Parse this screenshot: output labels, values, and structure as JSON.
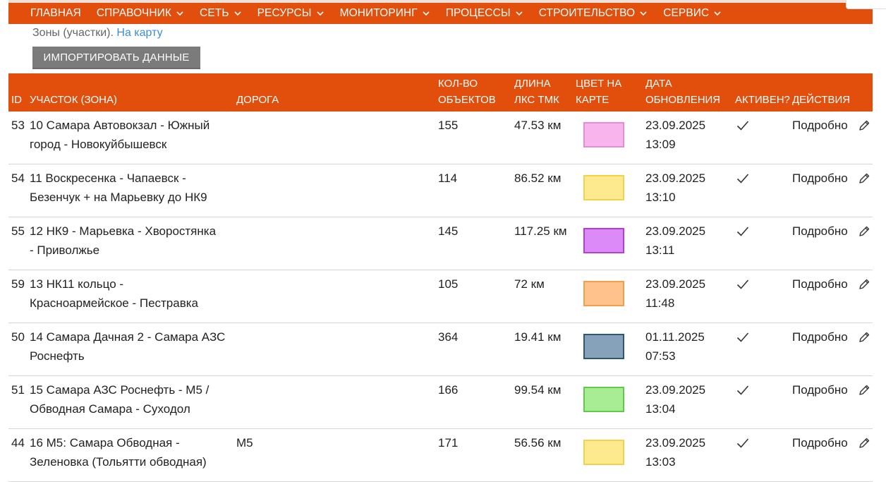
{
  "nav": {
    "items": [
      {
        "label": "Главная",
        "dropdown": false,
        "icon": ""
      },
      {
        "label": "Справочник",
        "dropdown": true,
        "icon": "chevron-down-icon"
      },
      {
        "label": "Сеть",
        "dropdown": true,
        "icon": "chevron-down-icon"
      },
      {
        "label": "Ресурсы",
        "dropdown": true,
        "icon": "chevron-down-icon"
      },
      {
        "label": "Мониторинг",
        "dropdown": true,
        "icon": "chevron-down-icon"
      },
      {
        "label": "Процессы",
        "dropdown": true,
        "icon": "chevron-down-icon"
      },
      {
        "label": "Строительство",
        "dropdown": true,
        "icon": "chevron-down-icon"
      },
      {
        "label": "Сервис",
        "dropdown": true,
        "icon": "chevron-down-icon"
      }
    ]
  },
  "breadcrumb": {
    "text": "Зоны (участки).",
    "link": "На карту"
  },
  "import_button": "Импортировать данные",
  "colors": {
    "accent": "#e24e0b",
    "button": "#7b7b7b",
    "link": "#3a8fd0"
  },
  "table": {
    "headers": {
      "id": "ID",
      "zone": "Участок (зона)",
      "road": "Дорога",
      "count": [
        "Кол-во",
        "объектов"
      ],
      "length": [
        "Длина",
        "ЛКС ТМК"
      ],
      "color": [
        "Цвет на",
        "карте"
      ],
      "date": [
        "Дата",
        "обновления"
      ],
      "active": "Активен?",
      "actions": "Действия"
    },
    "rows": [
      {
        "id": "53",
        "zone": [
          "10 Самара Автовокзал - Южный",
          "город - Новокуйбышевск"
        ],
        "road": "",
        "count": "155",
        "length": "47.53 км",
        "fill": "#f8b4ec",
        "border": "#e58bd8",
        "date": [
          "23.09.2025",
          "13:09"
        ],
        "active": true,
        "action": "Подробно"
      },
      {
        "id": "54",
        "zone": [
          "11 Воскресенка - Чапаевск -",
          "Безенчук + на Марьевку до НК9"
        ],
        "road": "",
        "count": "114",
        "length": "86.52 км",
        "fill": "#fde98e",
        "border": "#f0d24b",
        "date": [
          "23.09.2025",
          "13:10"
        ],
        "active": true,
        "action": "Подробно"
      },
      {
        "id": "55",
        "zone": [
          "12 НК9 - Марьевка - Хворостянка",
          "- Приволжье"
        ],
        "road": "",
        "count": "145",
        "length": "117.25 км",
        "fill": "#dc8af8",
        "border": "#b43ed8",
        "date": [
          "23.09.2025",
          "13:11"
        ],
        "active": true,
        "action": "Подробно"
      },
      {
        "id": "59",
        "zone": [
          "13 НК11 кольцо -",
          "Красноармейское - Пестравка"
        ],
        "road": "",
        "count": "105",
        "length": "72 км",
        "fill": "#fec28c",
        "border": "#f0a04a",
        "date": [
          "23.09.2025",
          "11:48"
        ],
        "active": true,
        "action": "Подробно"
      },
      {
        "id": "50",
        "zone": [
          "14 Самара Дачная 2 - Самара АЗС",
          "Роснефть"
        ],
        "road": "",
        "count": "364",
        "length": "19.41 км",
        "fill": "#86a2bb",
        "border": "#2f5674",
        "date": [
          "01.11.2025",
          "07:53"
        ],
        "active": true,
        "action": "Подробно"
      },
      {
        "id": "51",
        "zone": [
          "15 Самара АЗС Роснефть - М5 /",
          "Обводная Самара - Суходол"
        ],
        "road": "",
        "count": "166",
        "length": "99.54 км",
        "fill": "#a8ec94",
        "border": "#5fcb4a",
        "date": [
          "23.09.2025",
          "13:04"
        ],
        "active": true,
        "action": "Подробно"
      },
      {
        "id": "44",
        "zone": [
          "16 М5: Самара Обводная -",
          "Зеленовка (Тольятти обводная)"
        ],
        "road": "М5",
        "count": "171",
        "length": "56.56 км",
        "fill": "#fde98e",
        "border": "#f0d24b",
        "date": [
          "23.09.2025",
          "13:03"
        ],
        "active": true,
        "action": "Подробно"
      }
    ]
  }
}
